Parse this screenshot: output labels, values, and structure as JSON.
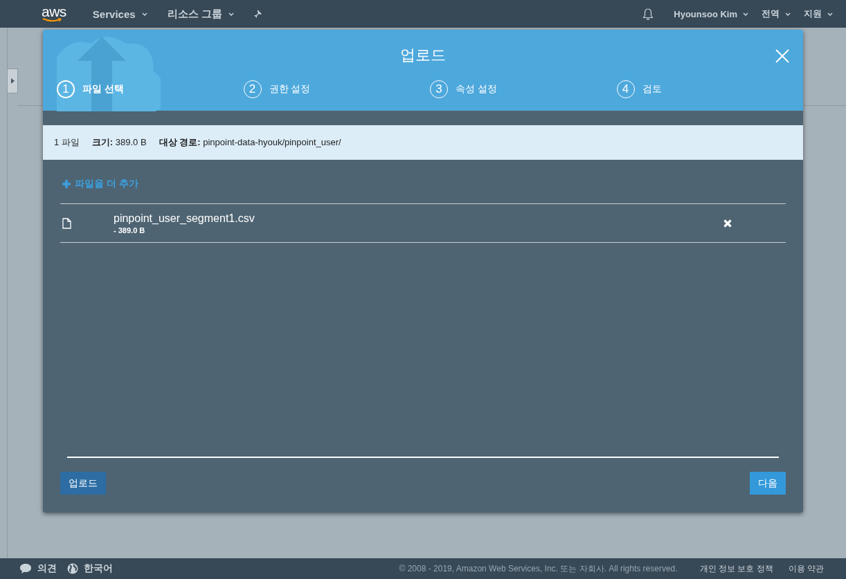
{
  "navbar": {
    "logo": "aws",
    "items": [
      {
        "label": "Services",
        "kind": "dropdown"
      },
      {
        "label": "리소스 그룹",
        "kind": "dropdown"
      },
      {
        "kind": "pin"
      }
    ],
    "right_items": [
      {
        "label": "Hyounsoo Kim"
      },
      {
        "label": "전역"
      },
      {
        "label": "지원"
      }
    ]
  },
  "dialog": {
    "title": "업로드",
    "steps": [
      {
        "number": "1",
        "label": "파일 선택",
        "selected": true
      },
      {
        "number": "2",
        "label": "권한 설정",
        "selected": false
      },
      {
        "number": "3",
        "label": "속성 설정",
        "selected": false
      },
      {
        "number": "4",
        "label": "검토",
        "selected": false
      }
    ],
    "summary": [
      "1 파일",
      "**크기:** 389.0 B",
      "**대상 경로:** pinpoint-data-hyouk/pinpoint_user/"
    ],
    "add_more": "파일을 더 추가",
    "files": [
      {
        "name": "pinpoint_user_segment1.csv",
        "size": "- 389.0 B"
      }
    ],
    "buttons": {
      "upload": "업로드",
      "next": "다음"
    }
  },
  "footer": {
    "feedback": "의견",
    "language": "한국어",
    "copyright": "© 2008 - 2019, Amazon Web Services, Inc. 또는 자회사. All rights reserved.",
    "links": [
      "개인 정보 보호 정책",
      "이용 약관"
    ]
  }
}
